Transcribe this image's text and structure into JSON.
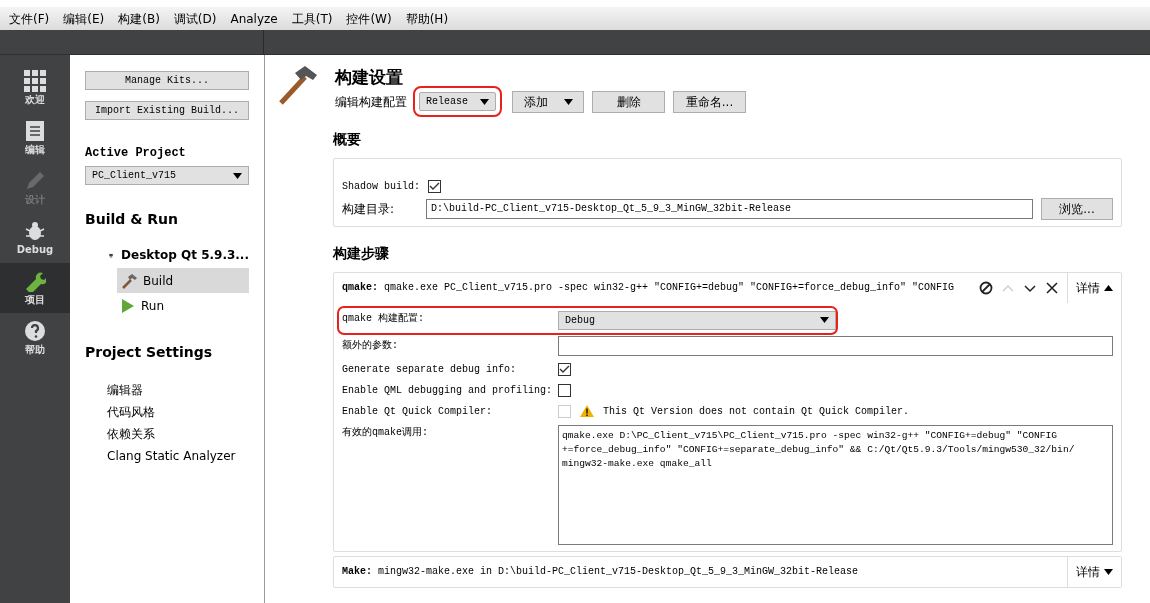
{
  "menu": [
    {
      "label": "文件(F)"
    },
    {
      "label": "编辑(E)"
    },
    {
      "label": "构建(B)"
    },
    {
      "label": "调试(D)"
    },
    {
      "label": "Analyze"
    },
    {
      "label": "工具(T)"
    },
    {
      "label": "控件(W)"
    },
    {
      "label": "帮助(H)"
    }
  ],
  "modes": [
    {
      "kind": "welcome",
      "label": "欢迎",
      "selected": false,
      "disabled": false
    },
    {
      "kind": "edit",
      "label": "编辑",
      "selected": false,
      "disabled": false
    },
    {
      "kind": "design",
      "label": "设计",
      "selected": false,
      "disabled": true
    },
    {
      "kind": "debug",
      "label": "Debug",
      "selected": false,
      "disabled": false
    },
    {
      "kind": "projects",
      "label": "项目",
      "selected": true,
      "disabled": false
    },
    {
      "kind": "help",
      "label": "帮助",
      "selected": false,
      "disabled": false
    }
  ],
  "project_pane": {
    "buttons": [
      "Manage Kits...",
      "Import Existing Build..."
    ],
    "active_project_heading": "Active Project",
    "active_project": "PC_Client_v715",
    "build_run_heading": "Build & Run",
    "kit": "Desktop Qt 5.9.3...",
    "kit_items": [
      {
        "kind": "build",
        "label": "Build",
        "selected": true
      },
      {
        "kind": "run",
        "label": "Run",
        "selected": false
      }
    ],
    "settings_heading": "Project Settings",
    "settings_items": [
      {
        "label": "编辑器"
      },
      {
        "label": "代码风格"
      },
      {
        "label": "依赖关系"
      },
      {
        "label": "Clang Static Analyzer"
      }
    ]
  },
  "build_settings": {
    "title": "构建设置",
    "config_label": "编辑构建配置",
    "config": "Release",
    "config_highlighted": true,
    "buttons": [
      {
        "label": "添加",
        "dropdown": true
      },
      {
        "label": "删除",
        "dropdown": false
      },
      {
        "label": "重命名...",
        "dropdown": false
      }
    ],
    "overview_heading": "概要",
    "shadow_build_label": "Shadow build:",
    "shadow_build": true,
    "build_dir_label": "构建目录:",
    "build_dir": "D:\\build-PC_Client_v715-Desktop_Qt_5_9_3_MinGW_32bit-Release",
    "browse": "浏览...",
    "steps_heading": "构建步骤",
    "steps": [
      {
        "summary": "**qmake:** qmake.exe PC_Client_v715.pro -spec win32-g++ \"CONFIG+=debug\" \"CONFIG+=force_debug_info\" \"CONFIG",
        "details": "详情",
        "expanded": true,
        "tools": true,
        "rows": [
          {
            "kind": "combo",
            "label": "qmake 构建配置:",
            "value": "Debug",
            "highlighted": true
          },
          {
            "kind": "field",
            "label": "额外的参数:"
          },
          {
            "kind": "checkbox",
            "label": "Generate separate debug info:",
            "checked": true,
            "disabled": false
          },
          {
            "kind": "checkbox",
            "label": "Enable QML debugging and profiling:",
            "checked": false,
            "disabled": false
          },
          {
            "kind": "checkbox",
            "label": "Enable Qt Quick Compiler:",
            "checked": false,
            "disabled": true,
            "warning": "This Qt Version does not contain Qt Quick Compiler."
          },
          {
            "kind": "textarea",
            "label": "有效的qmake调用:",
            "value": "qmake.exe D:\\PC_Client_v715\\PC_Client_v715.pro -spec win32-g++ \"CONFIG+=debug\" \"CONFIG\n+=force_debug_info\" \"CONFIG+=separate_debug_info\" && C:/Qt/Qt5.9.3/Tools/mingw530_32/bin/\nmingw32-make.exe qmake_all"
          }
        ]
      },
      {
        "summary": "**Make:** mingw32-make.exe in D:\\build-PC_Client_v715-Desktop_Qt_5_9_3_MinGW_32bit-Release",
        "details": "详情",
        "expanded": false,
        "tools": false
      }
    ]
  }
}
